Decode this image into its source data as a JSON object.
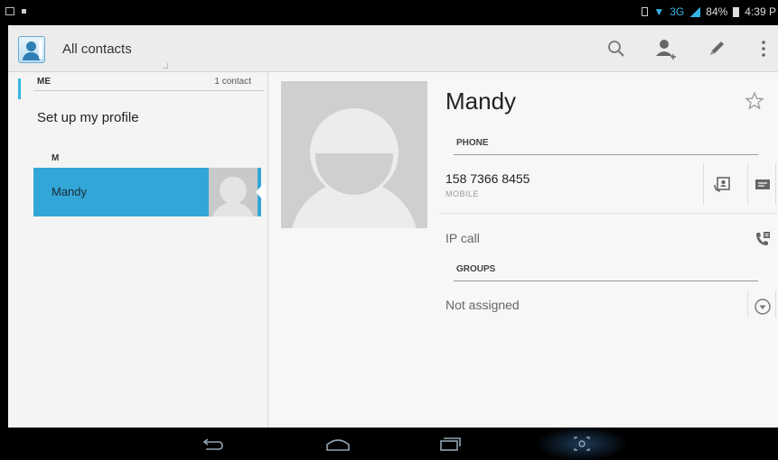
{
  "status_bar": {
    "network": "3G",
    "battery": "84%",
    "time": "4:39 P"
  },
  "action_bar": {
    "title": "All contacts",
    "icons": [
      "search-icon",
      "add-contact-icon",
      "edit-icon",
      "overflow-menu-icon"
    ]
  },
  "contact_list": {
    "me_header": "ME",
    "me_count": "1 contact",
    "setup_profile": "Set up my profile",
    "letter_header": "M",
    "contacts": [
      {
        "name": "Mandy",
        "selected": true
      }
    ]
  },
  "detail": {
    "name": "Mandy",
    "phone_header": "PHONE",
    "phone_number": "158 7366 8455",
    "phone_type": "MOBILE",
    "ip_call": "IP call",
    "groups_header": "GROUPS",
    "groups_value": "Not assigned"
  },
  "colors": {
    "accent": "#33b5e5",
    "selected_row": "#33a6d8"
  },
  "nav_bar": {
    "buttons": [
      "back-icon",
      "home-icon",
      "recent-apps-icon",
      "screenshot-icon"
    ]
  }
}
